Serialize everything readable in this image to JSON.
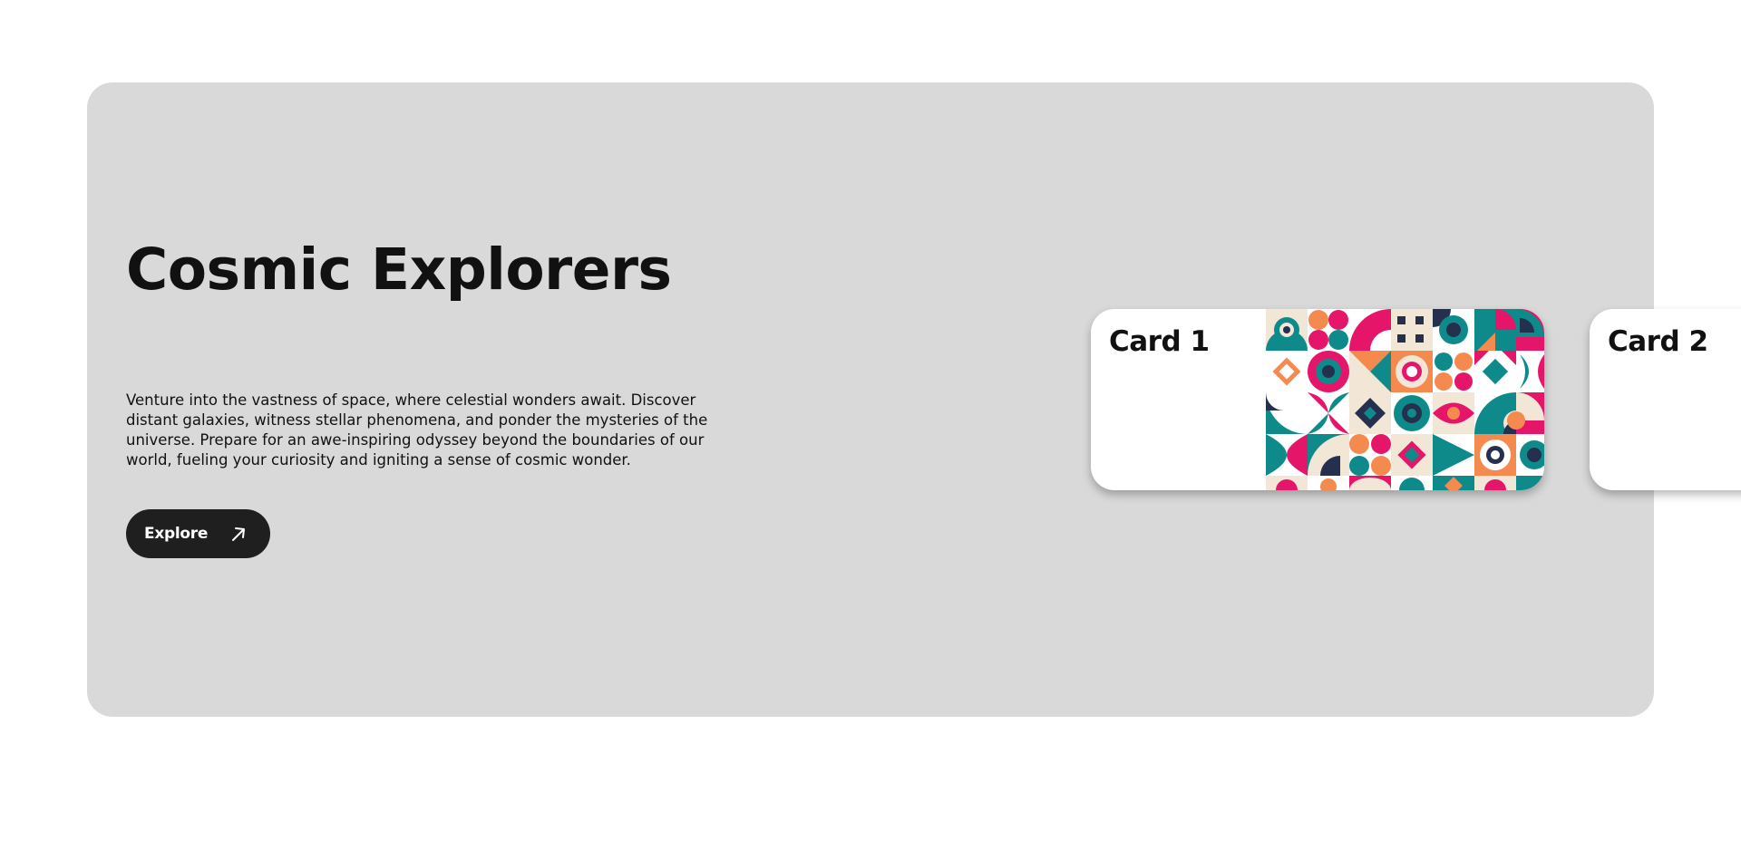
{
  "hero": {
    "title": "Cosmic Explorers",
    "description": "Venture into the vastness of space, where celestial wonders await. Discover distant galaxies, witness stellar phenomena, and ponder the mysteries of the universe. Prepare for an awe-inspiring odyssey beyond the boundaries of our world, fueling your curiosity and igniting a sense of cosmic wonder.",
    "button": {
      "label": "Explore",
      "icon": "arrow-up-right-icon"
    }
  },
  "cards": [
    {
      "title": "Card 1",
      "art": "geometric-pattern"
    },
    {
      "title": "Card 2"
    }
  ],
  "colors": {
    "background": "#ffffff",
    "hero_bg": "#d9d9d9",
    "button_bg": "#1f1f1f",
    "button_text": "#ffffff",
    "text": "#111111",
    "pattern_teal": "#0e8a8a",
    "pattern_pink": "#e5156a",
    "pattern_orange": "#f58a4f",
    "pattern_navy": "#24304d",
    "pattern_cream": "#f2e6d6"
  }
}
